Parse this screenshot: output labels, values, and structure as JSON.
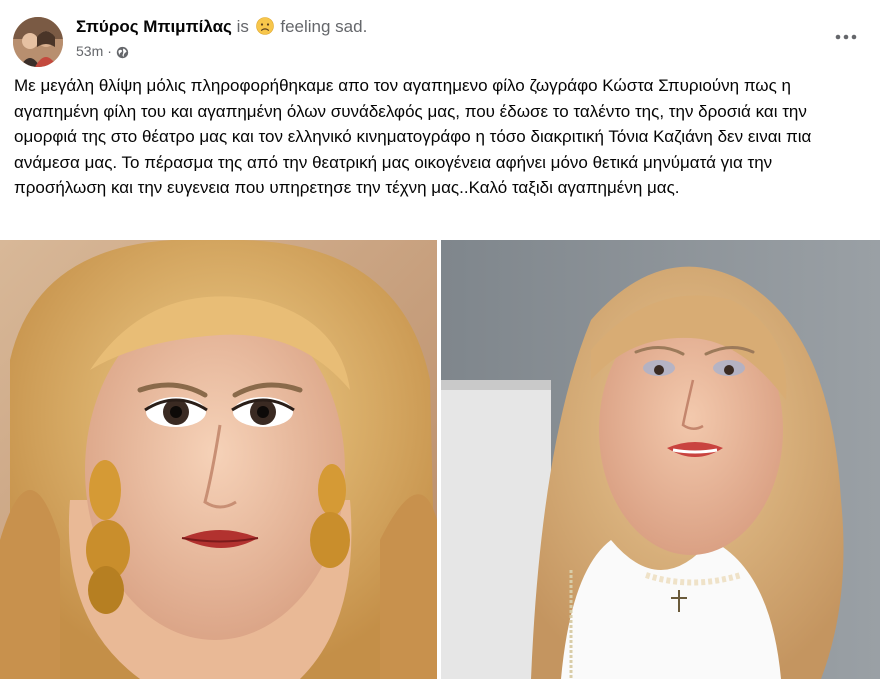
{
  "post": {
    "author": {
      "name": "Σπύρος Μπιμπίλας",
      "is_text": "is",
      "feeling_text": "feeling sad."
    },
    "meta": {
      "time": "53m",
      "separator": "·",
      "audience_icon": "globe-icon"
    },
    "more_icon": "more-options-icon",
    "body_text": "Με μεγάλη θλίψη μόλις πληροφορήθηκαμε απο τον αγαπημενο φίλο ζωγράφο Κώστα Σπυριούνη πως η αγαπημένη φίλη του και αγαπημένη όλων συνάδελφός μας, που έδωσε το ταλέντο της, την δροσιά και την ομορφιά της στο θέατρο μας και τον ελληνικό κινηματογράφο η τόσο διακριτική Τόνια Καζιάνη δεν ειναι πια ανάμεσα μας. Το πέρασμα της από την θεατρική μας οικογένεια αφήνει μόνο θετικά μηνύματά για την προσήλωση και  την ευγενεια που υπηρετησε την τέχνη μας..Καλό ταξιδι αγαπημένη μας.",
    "photos": [
      {
        "icon": "portrait-photo-young"
      },
      {
        "icon": "portrait-photo-older"
      }
    ]
  },
  "colors": {
    "name": "#050505",
    "secondary": "#65676b",
    "hair": "#d9a860",
    "background_left": "#c9a080",
    "background_right": "#8a8f94"
  }
}
